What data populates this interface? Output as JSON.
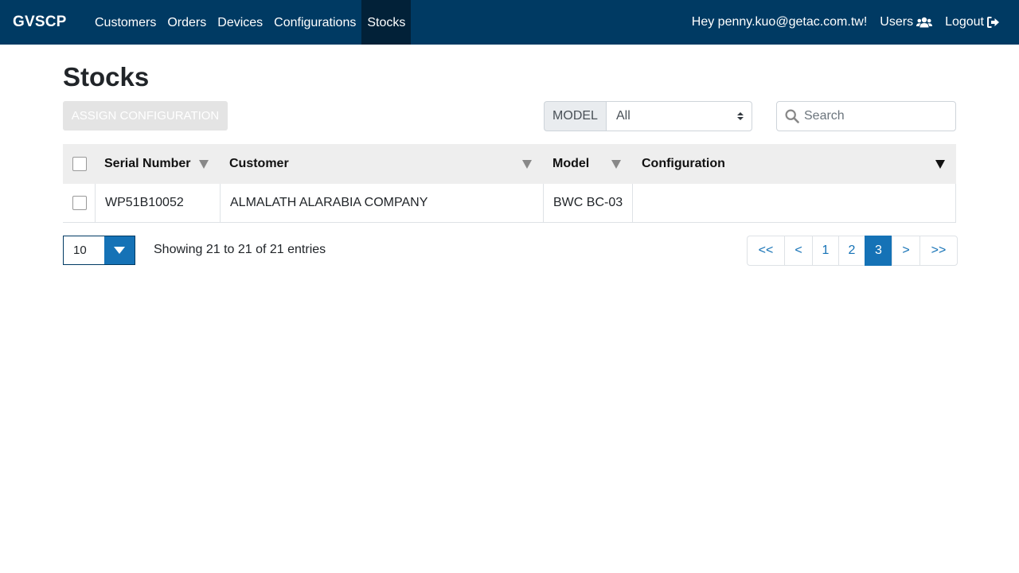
{
  "nav": {
    "brand": "GVSCP",
    "links": [
      "Customers",
      "Orders",
      "Devices",
      "Configurations",
      "Stocks"
    ],
    "active": "Stocks",
    "greeting": "Hey penny.kuo@getac.com.tw!",
    "users_label": "Users",
    "logout_label": "Logout"
  },
  "page": {
    "title": "Stocks",
    "assign_button": "ASSIGN CONFIGURATION",
    "model_filter_label": "MODEL",
    "model_filter_value": "All",
    "search_placeholder": "Search"
  },
  "table": {
    "columns": [
      "Serial Number",
      "Customer",
      "Model",
      "Configuration"
    ],
    "rows": [
      {
        "serial": "WP51B10052",
        "customer": "ALMALATH ALARABIA COMPANY",
        "model": "BWC BC-03",
        "configuration": ""
      }
    ]
  },
  "footer": {
    "page_size": "10",
    "showing": "Showing 21 to 21 of 21 entries",
    "pages": [
      "<<",
      "<",
      "1",
      "2",
      "3",
      ">",
      ">>"
    ],
    "current_page": "3"
  },
  "colors": {
    "navbar": "#003a63",
    "active_nav": "#022138",
    "primary": "#1572b6",
    "header_row": "#eeeeee"
  }
}
